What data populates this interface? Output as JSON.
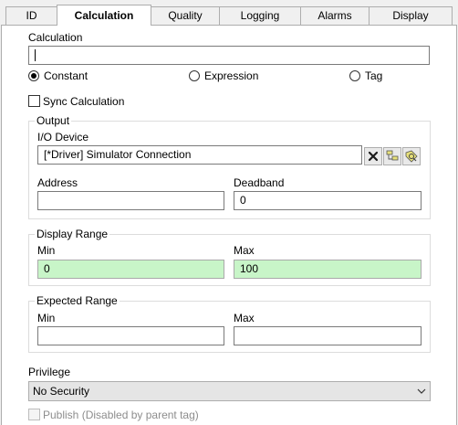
{
  "tabs": [
    {
      "label": "ID",
      "active": false
    },
    {
      "label": "Calculation",
      "active": true
    },
    {
      "label": "Quality",
      "active": false
    },
    {
      "label": "Logging",
      "active": false
    },
    {
      "label": "Alarms",
      "active": false
    },
    {
      "label": "Display",
      "active": false
    }
  ],
  "calculation": {
    "label": "Calculation",
    "value": "",
    "modes": [
      {
        "label": "Constant",
        "selected": true
      },
      {
        "label": "Expression",
        "selected": false
      },
      {
        "label": "Tag",
        "selected": false
      }
    ],
    "sync_label": "Sync Calculation"
  },
  "output": {
    "title": "Output",
    "io_device_label": "I/O Device",
    "io_device_value": "[*Driver]    Simulator Connection",
    "address_label": "Address",
    "address_value": "",
    "deadband_label": "Deadband",
    "deadband_value": "0"
  },
  "display_range": {
    "title": "Display Range",
    "min_label": "Min",
    "min_value": "0",
    "max_label": "Max",
    "max_value": "100"
  },
  "expected_range": {
    "title": "Expected Range",
    "min_label": "Min",
    "min_value": "",
    "max_label": "Max",
    "max_value": ""
  },
  "privilege": {
    "label": "Privilege",
    "selected": "No Security"
  },
  "publish": {
    "label": "Publish (Disabled by parent tag)"
  },
  "colors": {
    "range_field_bg": "#c8f5c8",
    "panel_bg": "#ffffff",
    "window_bg": "#f0f0f0"
  }
}
